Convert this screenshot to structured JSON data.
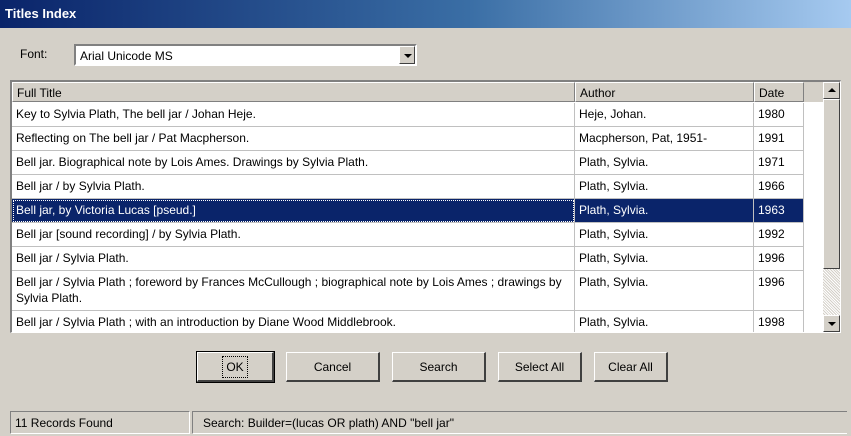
{
  "window": {
    "title": "Titles Index"
  },
  "font": {
    "label": "Font:",
    "value": "Arial Unicode MS"
  },
  "grid": {
    "columns": [
      "Full Title",
      "Author",
      "Date"
    ],
    "rows": [
      {
        "title": "Key to Sylvia Plath, The bell jar / Johan Heje.",
        "author": "Heje, Johan.",
        "date": "1980"
      },
      {
        "title": "Reflecting on The bell jar / Pat Macpherson.",
        "author": "Macpherson, Pat, 1951-",
        "date": "1991"
      },
      {
        "title": "Bell jar. Biographical note by Lois Ames. Drawings by Sylvia Plath.",
        "author": "Plath, Sylvia.",
        "date": "1971"
      },
      {
        "title": "Bell jar / by Sylvia Plath.",
        "author": "Plath, Sylvia.",
        "date": "1966"
      },
      {
        "title": "Bell jar, by Victoria Lucas [pseud.]",
        "author": "Plath, Sylvia.",
        "date": "1963"
      },
      {
        "title": "Bell jar [sound recording] / by Sylvia Plath.",
        "author": "Plath, Sylvia.",
        "date": "1992"
      },
      {
        "title": "Bell jar / Sylvia Plath.",
        "author": "Plath, Sylvia.",
        "date": "1996"
      },
      {
        "title": "Bell jar / Sylvia Plath ; foreword by Frances McCullough ; biographical note by Lois Ames ; drawings by Sylvia Plath.",
        "author": "Plath, Sylvia.",
        "date": "1996"
      },
      {
        "title": "Bell jar / Sylvia Plath ; with an introduction by Diane Wood Middlebrook.",
        "author": "Plath, Sylvia.",
        "date": "1998"
      }
    ],
    "selected_index": 4
  },
  "buttons": {
    "ok": "OK",
    "cancel": "Cancel",
    "search": "Search",
    "select_all": "Select All",
    "clear_all": "Clear All"
  },
  "status": {
    "records": "11 Records Found",
    "search": "Search: Builder=(lucas OR plath) AND \"bell jar\""
  },
  "colors": {
    "selection": "#0a246a",
    "face": "#d4d0c8"
  }
}
